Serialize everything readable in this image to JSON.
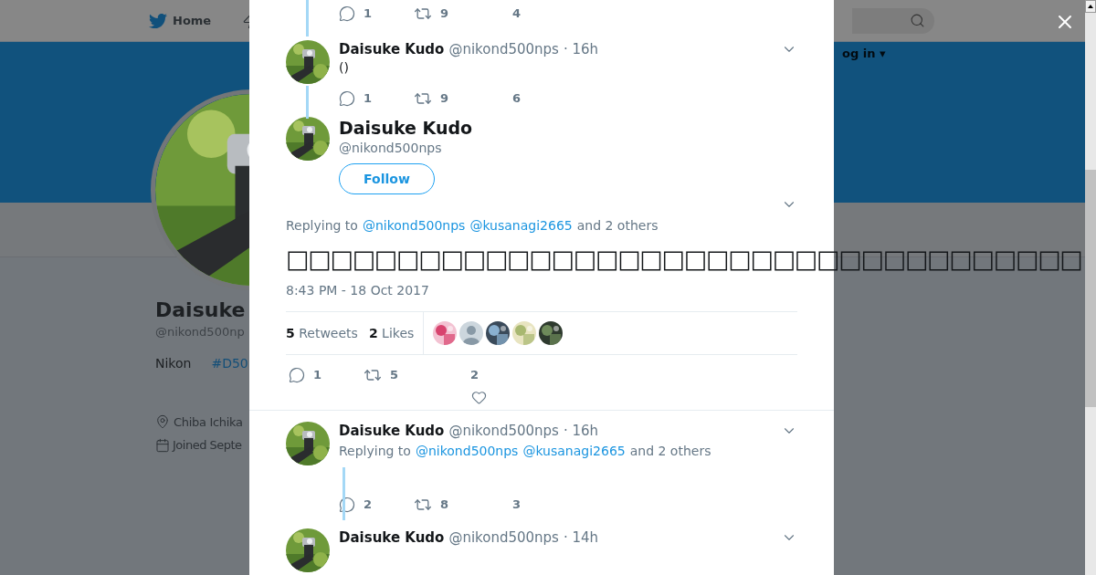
{
  "page": {
    "nav": {
      "home": "Home",
      "login": "og in ▾"
    },
    "profile": {
      "name": "Daisuke",
      "handle": "@nikond500np",
      "bio": "Nikon",
      "hashtag": "#D50",
      "location": "Chiba Ichika",
      "joined": "Joined Septe"
    }
  },
  "thread": {
    "top_actions": {
      "replies": "1",
      "retweets": "9",
      "likes": "4"
    },
    "tweets_before": [
      {
        "name": "Daisuke Kudo",
        "handle": "@nikond500nps",
        "time": "· 16h",
        "text": "()",
        "actions": {
          "replies": "1",
          "retweets": "9",
          "likes": "6"
        }
      }
    ],
    "main": {
      "name": "Daisuke Kudo",
      "handle": "@nikond500nps",
      "follow": "Follow",
      "replying": {
        "prefix": "Replying to",
        "mentions": [
          "@nikond500nps",
          "@kusanagi2665"
        ],
        "suffix": "and 2 others"
      },
      "text": "□□□□□□□□□□□□□□□□□□□□□□□□□□□□□□□□□□□□",
      "time": "8:43 PM - 18 Oct 2017",
      "stats": {
        "retweets_count": "5",
        "retweets_label": "Retweets",
        "likes_count": "2",
        "likes_label": "Likes",
        "likers": [
          {
            "kind": "picture"
          },
          {
            "kind": "silhouette"
          },
          {
            "kind": "picture"
          },
          {
            "kind": "picture"
          },
          {
            "kind": "picture"
          }
        ]
      },
      "actions": {
        "replies": "1",
        "retweets": "5",
        "likes": "2"
      }
    },
    "replies": [
      {
        "name": "Daisuke Kudo",
        "handle": "@nikond500nps",
        "time": "· 16h",
        "replying": {
          "prefix": "Replying to",
          "mentions": [
            "@nikond500nps",
            "@kusanagi2665"
          ],
          "suffix": "and 2 others"
        },
        "actions": {
          "replies": "2",
          "retweets": "8",
          "likes": "3"
        }
      },
      {
        "name": "Daisuke Kudo",
        "handle": "@nikond500nps",
        "time": "· 14h"
      }
    ]
  }
}
